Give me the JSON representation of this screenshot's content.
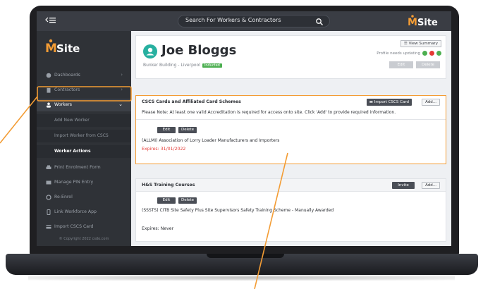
{
  "topbar": {
    "search_placeholder": "Search For Workers & Contractors",
    "brand": "Site",
    "brand_prefix": "M"
  },
  "sidebar": {
    "logo_prefix": "M",
    "logo_text": "Site",
    "items": [
      {
        "label": "Dashboards",
        "icon": "dashboard-icon"
      },
      {
        "label": "Contractors",
        "icon": "building-icon"
      },
      {
        "label": "Workers",
        "icon": "person-icon"
      },
      {
        "label": "Print Enrolment Form",
        "icon": "printer-icon"
      },
      {
        "label": "Manage PIN Entry",
        "icon": "keypad-icon"
      },
      {
        "label": "Re-Enrol",
        "icon": "refresh-icon"
      },
      {
        "label": "Link Workforce App",
        "icon": "phone-icon"
      },
      {
        "label": "Import CSCS Card",
        "icon": "card-icon"
      }
    ],
    "workers_sub": [
      {
        "label": "Add New Worker"
      },
      {
        "label": "Import Worker from CSCS"
      },
      {
        "label": "Worker Actions"
      }
    ],
    "footer": "© Copyright 2022 csdo.com"
  },
  "profile": {
    "name": "Joe Bloggs",
    "location": "Bunker Building - Liverpool",
    "status_badge": "Inducted",
    "view_summary": "View Summary",
    "profile_note": "Profile needs updating",
    "status_colors": [
      "#4caf50",
      "#e53935",
      "#4caf50"
    ],
    "edit_label": "Edit",
    "delete_label": "Delete"
  },
  "cscs": {
    "title": "CSCS Cards and Affiliated Card Schemes",
    "import_label": "Import CSCS Card",
    "add_label": "Add...",
    "note": "Please Note: At least one valid Accreditation is required for access onto site. Click 'Add' to provide required information.",
    "edit_label": "Edit",
    "delete_label": "Delete",
    "entry": "(ALLMI) Association of Lorry Loader Manufacturers and Importers",
    "expires": "Expires: 31/01/2022",
    "expires_color": "#e53935"
  },
  "hs": {
    "title": "H&S Training Courses",
    "invite_label": "Invite",
    "add_label": "Add...",
    "edit_label": "Edit",
    "delete_label": "Delete",
    "entry": "(SSSTS) CITB Site Safety Plus Site Supervisors Safety Training Scheme - Manually Awarded",
    "expires": "Expires: Never"
  },
  "accent": "#f39c34"
}
